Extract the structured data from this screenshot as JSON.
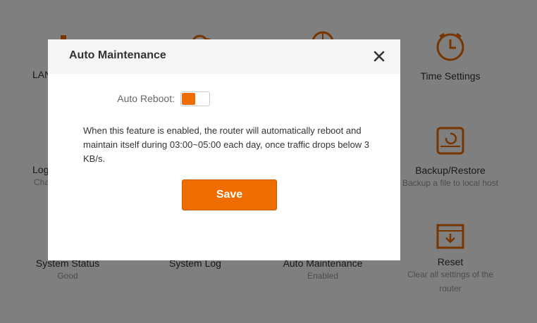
{
  "background": {
    "tiles": [
      {
        "label": "LAN",
        "sub": "",
        "icon": "gear-icon"
      },
      {
        "label": "",
        "sub": "",
        "icon": "cloud-icon"
      },
      {
        "label": "",
        "sub": "",
        "icon": "globe-icon"
      },
      {
        "label": "Time Settings",
        "sub": "",
        "icon": "clock-icon"
      },
      {
        "label": "Log",
        "sub": "Cha",
        "icon": ""
      },
      {
        "label": "Backup/Restore",
        "sub": "Backup a file to local host",
        "icon": "backup-icon"
      },
      {
        "label": "System Status",
        "sub": "Good",
        "icon": ""
      },
      {
        "label": "System Log",
        "sub": "",
        "icon": ""
      },
      {
        "label": "Auto Maintenance",
        "sub": "Enabled",
        "icon": ""
      },
      {
        "label": "Reset",
        "sub": "Clear all settings of the router",
        "icon": "reset-icon"
      }
    ],
    "icon_color": "#ef6c00"
  },
  "dialog": {
    "title": "Auto Maintenance",
    "close_icon": "close-icon",
    "auto_reboot_label": "Auto Reboot:",
    "auto_reboot_enabled": true,
    "description": "When this feature is enabled, the router will automatically reboot and maintain itself during 03:00~05:00 each day, once traffic drops below 3 KB/s.",
    "save_label": "Save",
    "accent_color": "#ef6c00"
  }
}
